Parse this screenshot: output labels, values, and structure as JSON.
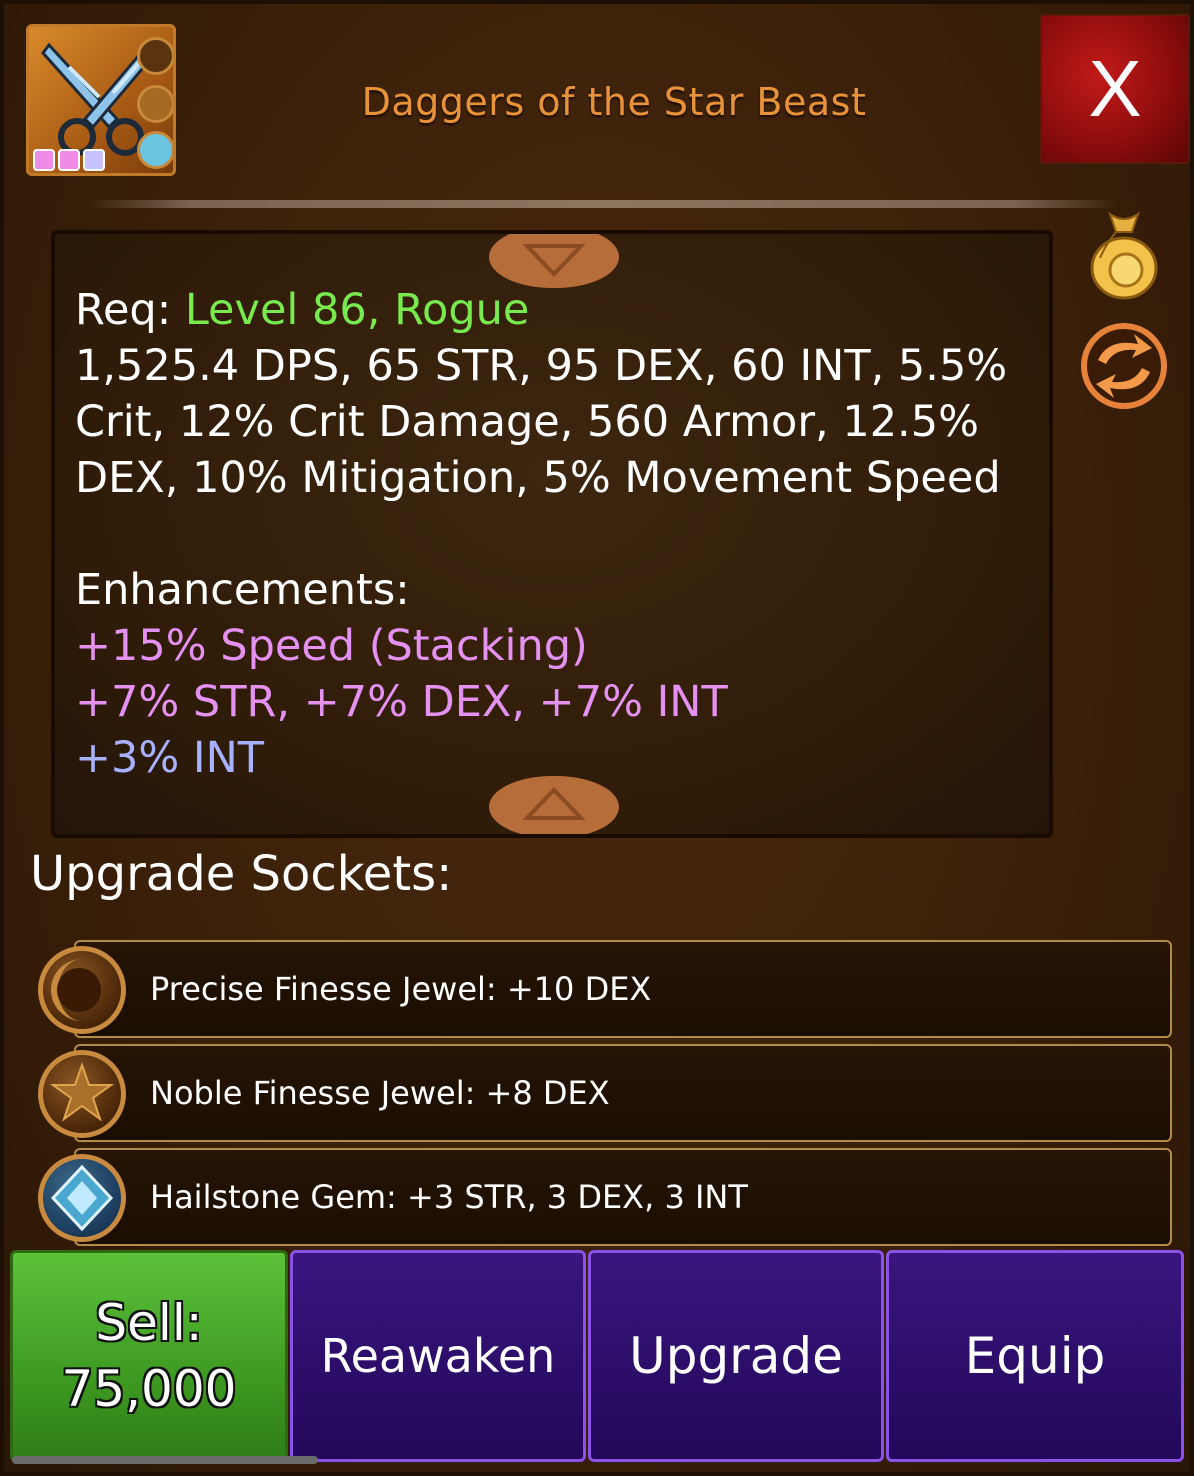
{
  "item": {
    "name": "Daggers of the Star Beast",
    "icon": "crossed-daggers-icon",
    "rank_dots": [
      "#f08ce8",
      "#f08ce8",
      "#c8c2ff"
    ]
  },
  "header": {
    "close_label": "X",
    "bag_icon": "gold-bag-icon",
    "swap_icon": "swap-arrows-icon"
  },
  "stats": {
    "req_prefix": "Req: ",
    "req_value": "Level 86, Rogue",
    "lines": [
      "1,525.4 DPS, 65 STR, 95 DEX, 60 INT, 5.5%",
      "Crit, 12% Crit Damage, 560 Armor, 12.5%",
      "DEX, 10% Mitigation, 5% Movement Speed"
    ],
    "enhancements_heading": "Enhancements:",
    "enhancements": [
      {
        "text": "+15% Speed (Stacking)",
        "color": "#e591f2"
      },
      {
        "text": "+7% STR, +7% DEX, +7% INT",
        "color": "#e591f2"
      },
      {
        "text": "+3% INT",
        "color": "#a8b1ff"
      }
    ]
  },
  "sockets": {
    "heading": "Upgrade Sockets:",
    "items": [
      {
        "label": "Precise Finesse Jewel: +10 DEX",
        "icon": "crescent-moon-jewel-icon"
      },
      {
        "label": "Noble Finesse Jewel: +8 DEX",
        "icon": "star-jewel-icon"
      },
      {
        "label": "Hailstone Gem: +3 STR, 3 DEX, 3 INT",
        "icon": "blue-diamond-gem-icon"
      }
    ]
  },
  "actions": {
    "sell_label": "Sell:",
    "sell_price": "75,000",
    "reawaken_label": "Reawaken",
    "upgrade_label": "Upgrade",
    "equip_label": "Equip"
  },
  "colors": {
    "title": "#e8923a",
    "green": "#79ea4d",
    "sell_button": "#4cae2e",
    "purple_button": "#2c0e6a",
    "close_button": "#a81212"
  }
}
